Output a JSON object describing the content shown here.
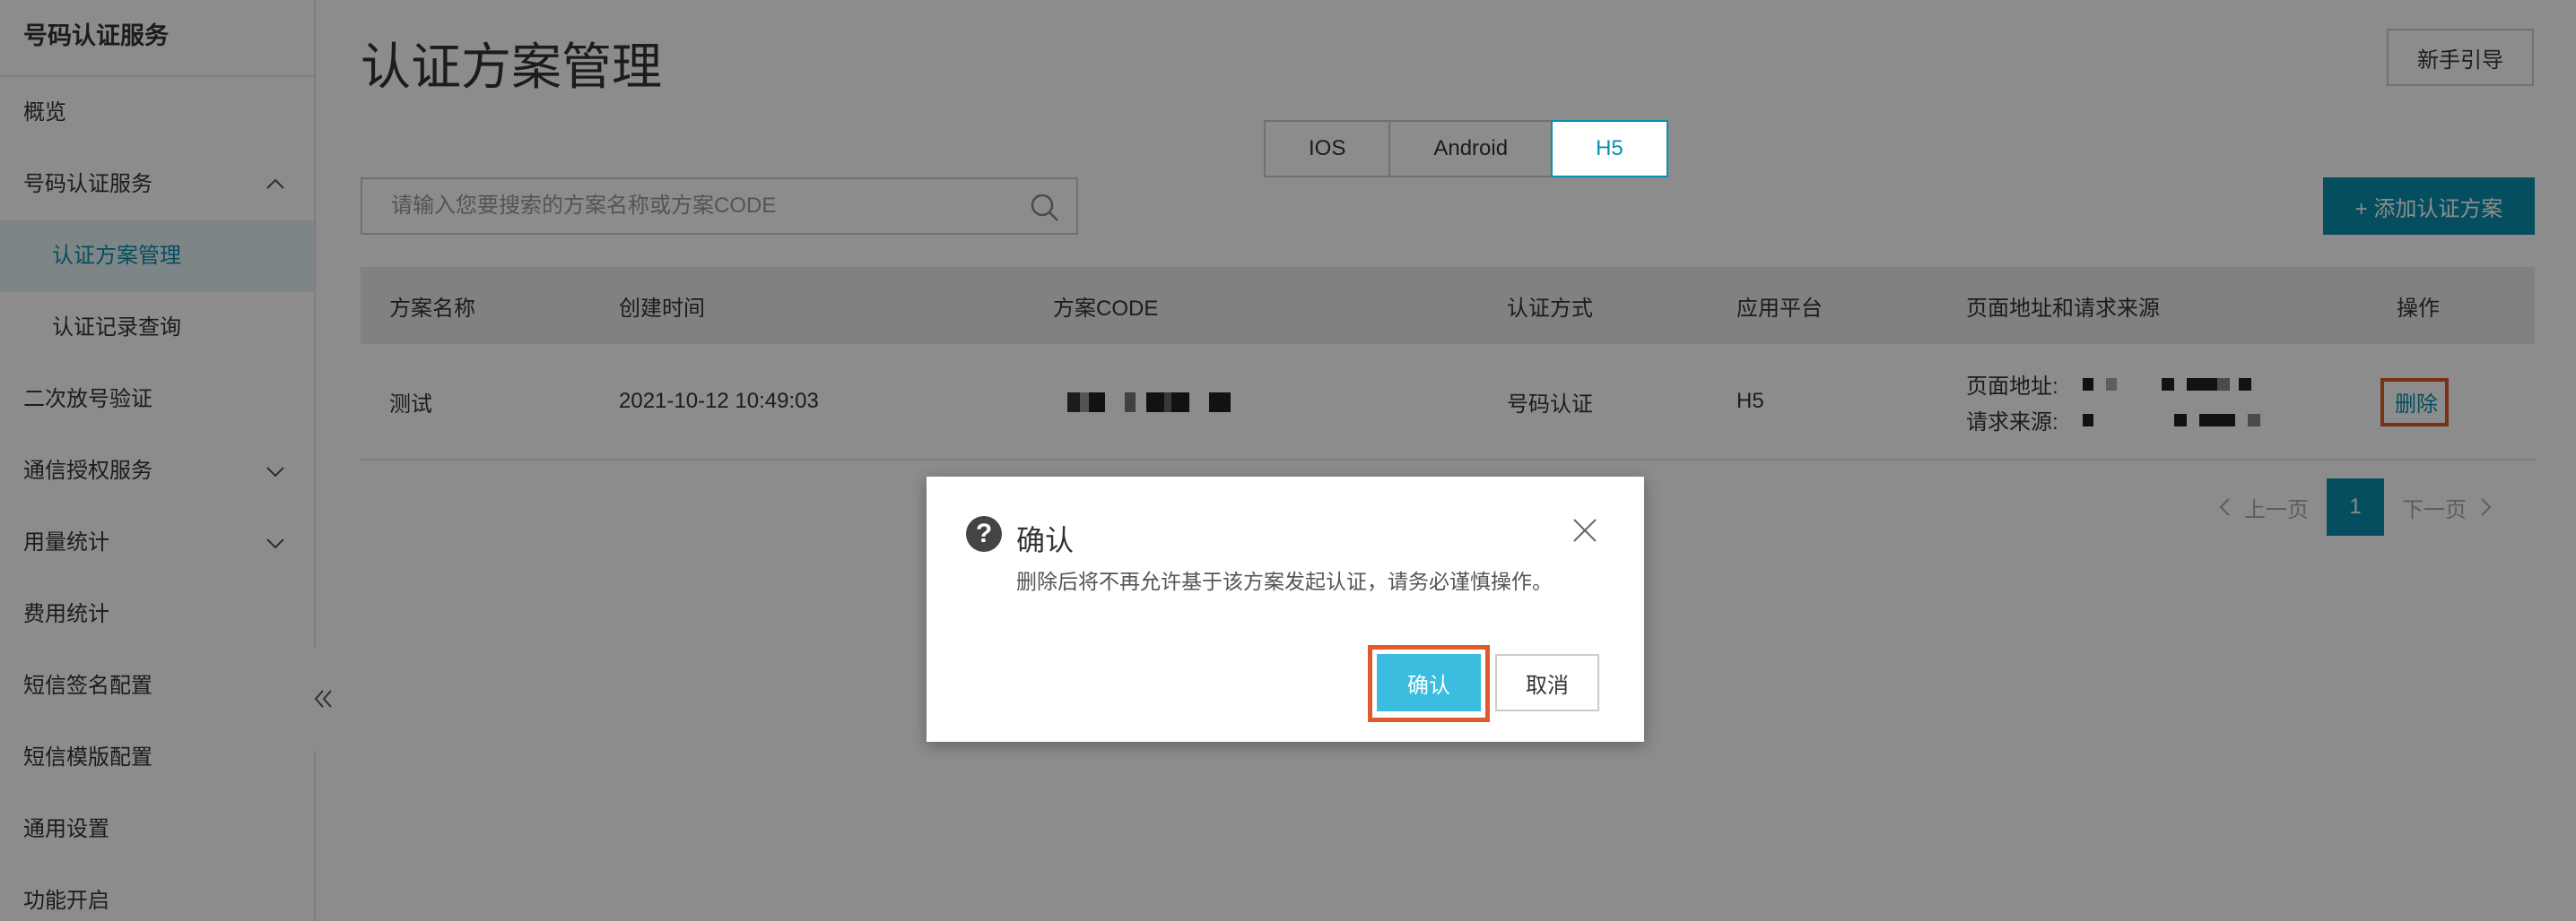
{
  "sidebar": {
    "title": "号码认证服务",
    "items": [
      {
        "label": "概览"
      },
      {
        "label": "号码认证服务"
      },
      {
        "label": "认证方案管理"
      },
      {
        "label": "认证记录查询"
      },
      {
        "label": "二次放号验证"
      },
      {
        "label": "通信授权服务"
      },
      {
        "label": "用量统计"
      },
      {
        "label": "费用统计"
      },
      {
        "label": "短信签名配置"
      },
      {
        "label": "短信模版配置"
      },
      {
        "label": "通用设置"
      },
      {
        "label": "功能开启"
      }
    ]
  },
  "header": {
    "title": "认证方案管理",
    "guide_label": "新手引导"
  },
  "platform_tabs": [
    {
      "label": "IOS"
    },
    {
      "label": "Android"
    },
    {
      "label": "H5",
      "selected": true
    }
  ],
  "search": {
    "placeholder": "请输入您要搜索的方案名称或方案CODE",
    "value": ""
  },
  "add_button_label": "+ 添加认证方案",
  "table": {
    "columns": [
      "方案名称",
      "创建时间",
      "方案CODE",
      "认证方式",
      "应用平台",
      "页面地址和请求来源",
      "操作"
    ],
    "rows": [
      {
        "name": "测试",
        "created": "2021-10-12 10:49:03",
        "code": "",
        "auth_method": "号码认证",
        "platform": "H5",
        "page_addr_label": "页面地址:",
        "source_label": "请求来源:",
        "action": "删除"
      }
    ]
  },
  "pager": {
    "prev": "上一页",
    "current": "1",
    "next": "下一页"
  },
  "dialog": {
    "title": "确认",
    "message": "删除后将不再允许基于该方案发起认证，请务必谨慎操作。",
    "confirm_label": "确认",
    "cancel_label": "取消"
  },
  "colors": {
    "accent": "#0a8fad",
    "confirm_button": "#3bbde0",
    "highlight_border": "#e05a2b",
    "overlay": "rgba(0,0,0,0.45)"
  },
  "icons": [
    "chevron-up-icon",
    "chevron-down-icon",
    "double-chevron-left-icon",
    "search-icon",
    "question-icon",
    "close-icon",
    "chevron-left-icon",
    "chevron-right-icon"
  ]
}
